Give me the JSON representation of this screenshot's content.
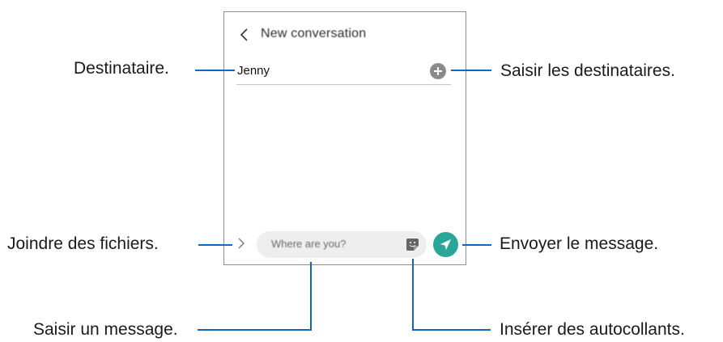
{
  "screen": {
    "title": "New conversation",
    "recipient": "Jenny",
    "message_placeholder": "Where are you?"
  },
  "callouts": {
    "recipient": "Destinataire.",
    "enter_recipients": "Saisir les destinataires.",
    "attach_files": "Joindre des fichiers.",
    "send_message": "Envoyer le message.",
    "enter_message": "Saisir un message.",
    "insert_stickers": "Insérer des autocollants."
  },
  "colors": {
    "callout_line": "#1565c0",
    "send_button": "#2aa59a",
    "add_button": "#8a8a8a"
  },
  "icons": {
    "back": "chevron-left-icon",
    "add": "plus-circle-icon",
    "attach": "chevron-right-icon",
    "sticker": "sticker-icon",
    "send": "send-arrow-icon"
  }
}
